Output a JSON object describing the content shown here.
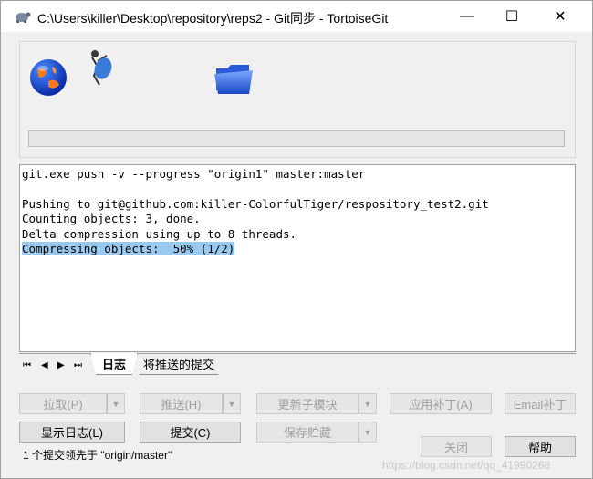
{
  "window": {
    "title": "C:\\Users\\killer\\Desktop\\repository\\reps2 - Git同步 - TortoiseGit",
    "minimize_glyph": "—",
    "maximize_glyph": "☐",
    "close_glyph": "✕"
  },
  "animation": {
    "icons": [
      "globe-icon",
      "running-figure-icon",
      "folder-icon"
    ],
    "progress_percent": 0
  },
  "log": {
    "lines": [
      {
        "text": "git.exe push -v --progress \"origin1\" master:master",
        "selected": false
      },
      {
        "text": "",
        "selected": false
      },
      {
        "text": "Pushing to git@github.com:killer-ColorfulTiger/respository_test2.git",
        "selected": false
      },
      {
        "text": "Counting objects: 3, done.",
        "selected": false
      },
      {
        "text": "Delta compression using up to 8 threads.",
        "selected": false
      },
      {
        "text": "Compressing objects:  50% (1/2)",
        "selected": true
      }
    ]
  },
  "tabs": {
    "nav": [
      "⏮",
      "◀",
      "▶",
      "⏭"
    ],
    "items": [
      {
        "label": "日志",
        "active": true
      },
      {
        "label": "将推送的提交",
        "active": false
      }
    ]
  },
  "buttons": {
    "pull": "拉取(P)",
    "push": "推送(H)",
    "update_submodules": "更新子模块",
    "apply_patch": "应用补丁(A)",
    "email_patch": "Email补丁",
    "show_log": "显示日志(L)",
    "commit": "提交(C)",
    "stash": "保存贮藏",
    "close": "关闭",
    "help": "帮助",
    "dropdown_glyph": "▼"
  },
  "status": {
    "text": "1 个提交领先于 \"origin/master\""
  },
  "watermark": {
    "text": "https://blog.csdn.net/qq_41990268"
  },
  "colors": {
    "selection": "#99c9ef",
    "window_bg": "#f0f0f0",
    "disabled_text": "#a0a0a0"
  }
}
